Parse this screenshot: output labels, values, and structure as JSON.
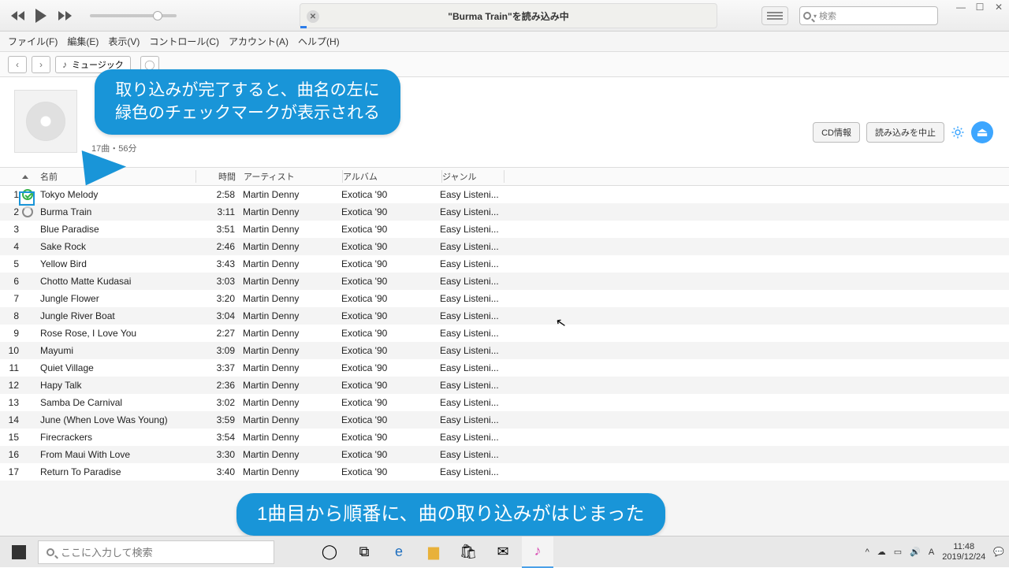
{
  "lcd_text": "\"Burma Train\"を読み込み中",
  "search_placeholder": "検索",
  "menu": [
    "ファイル(F)",
    "編集(E)",
    "表示(V)",
    "コントロール(C)",
    "アカウント(A)",
    "ヘルプ(H)"
  ],
  "music_label": "ミュージック",
  "album_meta": "17曲・56分",
  "btn_cdinfo": "CD情報",
  "btn_stop": "読み込みを中止",
  "headers": {
    "name": "名前",
    "time": "時間",
    "artist": "アーティスト",
    "album": "アルバム",
    "genre": "ジャンル"
  },
  "tracks": [
    {
      "n": "1",
      "st": "ok",
      "name": "Tokyo Melody",
      "time": "2:58",
      "artist": "Martin Denny",
      "album": "Exotica '90",
      "genre": "Easy Listeni..."
    },
    {
      "n": "2",
      "st": "sp",
      "name": "Burma Train",
      "time": "3:11",
      "artist": "Martin Denny",
      "album": "Exotica '90",
      "genre": "Easy Listeni..."
    },
    {
      "n": "3",
      "st": "",
      "name": "Blue Paradise",
      "time": "3:51",
      "artist": "Martin Denny",
      "album": "Exotica '90",
      "genre": "Easy Listeni..."
    },
    {
      "n": "4",
      "st": "",
      "name": "Sake Rock",
      "time": "2:46",
      "artist": "Martin Denny",
      "album": "Exotica '90",
      "genre": "Easy Listeni..."
    },
    {
      "n": "5",
      "st": "",
      "name": "Yellow Bird",
      "time": "3:43",
      "artist": "Martin Denny",
      "album": "Exotica '90",
      "genre": "Easy Listeni..."
    },
    {
      "n": "6",
      "st": "",
      "name": "Chotto Matte Kudasai",
      "time": "3:03",
      "artist": "Martin Denny",
      "album": "Exotica '90",
      "genre": "Easy Listeni..."
    },
    {
      "n": "7",
      "st": "",
      "name": "Jungle Flower",
      "time": "3:20",
      "artist": "Martin Denny",
      "album": "Exotica '90",
      "genre": "Easy Listeni..."
    },
    {
      "n": "8",
      "st": "",
      "name": "Jungle River Boat",
      "time": "3:04",
      "artist": "Martin Denny",
      "album": "Exotica '90",
      "genre": "Easy Listeni..."
    },
    {
      "n": "9",
      "st": "",
      "name": "Rose Rose, I Love You",
      "time": "2:27",
      "artist": "Martin Denny",
      "album": "Exotica '90",
      "genre": "Easy Listeni..."
    },
    {
      "n": "10",
      "st": "",
      "name": "Mayumi",
      "time": "3:09",
      "artist": "Martin Denny",
      "album": "Exotica '90",
      "genre": "Easy Listeni..."
    },
    {
      "n": "11",
      "st": "",
      "name": "Quiet Village",
      "time": "3:37",
      "artist": "Martin Denny",
      "album": "Exotica '90",
      "genre": "Easy Listeni..."
    },
    {
      "n": "12",
      "st": "",
      "name": "Hapy Talk",
      "time": "2:36",
      "artist": "Martin Denny",
      "album": "Exotica '90",
      "genre": "Easy Listeni..."
    },
    {
      "n": "13",
      "st": "",
      "name": "Samba De Carnival",
      "time": "3:02",
      "artist": "Martin Denny",
      "album": "Exotica '90",
      "genre": "Easy Listeni..."
    },
    {
      "n": "14",
      "st": "",
      "name": "June (When Love Was Young)",
      "time": "3:59",
      "artist": "Martin Denny",
      "album": "Exotica '90",
      "genre": "Easy Listeni..."
    },
    {
      "n": "15",
      "st": "",
      "name": "Firecrackers",
      "time": "3:54",
      "artist": "Martin Denny",
      "album": "Exotica '90",
      "genre": "Easy Listeni..."
    },
    {
      "n": "16",
      "st": "",
      "name": "From Maui With Love",
      "time": "3:30",
      "artist": "Martin Denny",
      "album": "Exotica '90",
      "genre": "Easy Listeni..."
    },
    {
      "n": "17",
      "st": "",
      "name": "Return To Paradise",
      "time": "3:40",
      "artist": "Martin Denny",
      "album": "Exotica '90",
      "genre": "Easy Listeni..."
    }
  ],
  "callout1_l1": "取り込みが完了すると、曲名の左に",
  "callout1_l2": "緑色のチェックマークが表示される",
  "callout2": "1曲目から順番に、曲の取り込みがはじまった",
  "task_search": "ここに入力して検索",
  "tray_ime": "A",
  "clock_time": "11:48",
  "clock_date": "2019/12/24"
}
